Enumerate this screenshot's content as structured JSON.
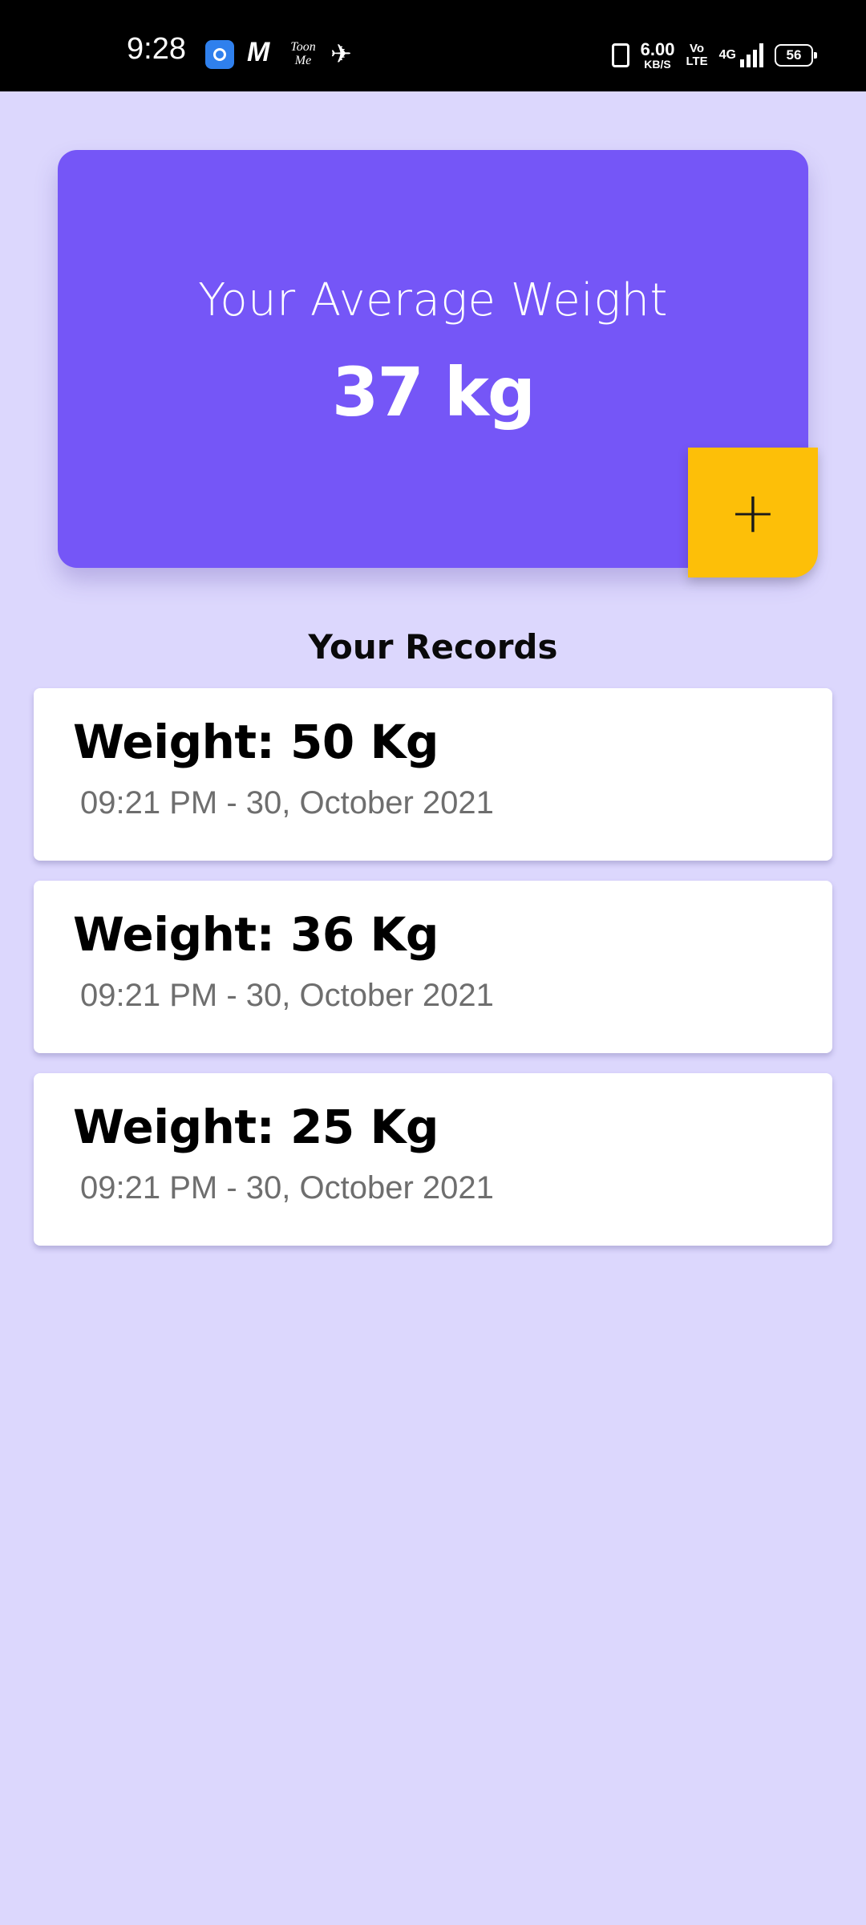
{
  "status_bar": {
    "time": "9:28",
    "app_toon_label": "Toon Me",
    "app_m_label": "M",
    "network_speed_value": "6.00",
    "network_speed_unit": "KB/S",
    "volte_line1": "Vo",
    "volte_line2": "LTE",
    "network_type": "4G",
    "battery_level": "56"
  },
  "summary": {
    "title": "Your Average Weight",
    "value": "37 kg",
    "add_button_label": "+"
  },
  "records": {
    "heading": "Your Records",
    "items": [
      {
        "weight": "Weight: 50 Kg",
        "time": "09:21 PM - 30, October 2021"
      },
      {
        "weight": "Weight: 36 Kg",
        "time": "09:21 PM - 30, October 2021"
      },
      {
        "weight": "Weight: 25 Kg",
        "time": "09:21 PM - 30, October 2021"
      }
    ]
  },
  "colors": {
    "background": "#dcd7fd",
    "card_accent": "#7556f7",
    "add_button": "#fdbf08",
    "record_card": "#ffffff",
    "secondary_text": "#6e6e6e"
  },
  "icons": {
    "add": "plus-icon",
    "vibrate": "vibrate-icon",
    "signal": "signal-icon",
    "battery": "battery-icon",
    "mute": "mute-icon"
  }
}
